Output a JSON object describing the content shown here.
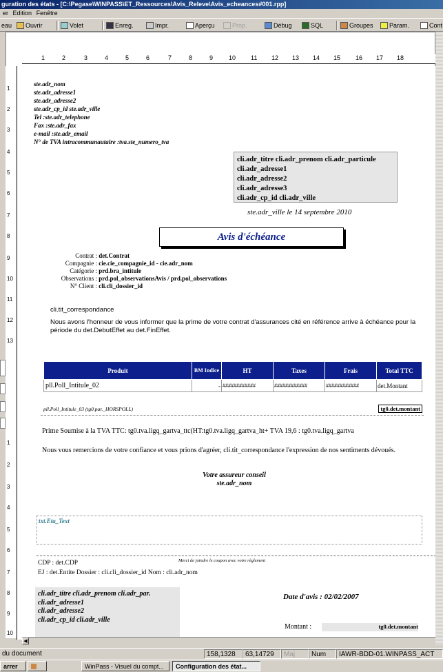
{
  "window": {
    "title": "guration des états - [C:\\Pegase\\WINPASS\\ET_Ressources\\Avis_Releve\\Avis_echeances#001.rpp]"
  },
  "menu": {
    "items": [
      "er",
      "Edition",
      "Fenêtre"
    ]
  },
  "toolbar": {
    "nouveau": "eau",
    "ouvrir": "Ouvrir",
    "volet": "Volet",
    "enreg": "Enreg.",
    "impr": "Impr.",
    "apercu": "Aperçu",
    "prop": "Prop.",
    "debug": "Débug",
    "sql": "SQL",
    "groupes": "Groupes",
    "param": "Param.",
    "cont": "Cont"
  },
  "ruler": {
    "h_ticks": [
      "1",
      "2",
      "3",
      "4",
      "5",
      "6",
      "7",
      "8",
      "9",
      "10",
      "11",
      "12",
      "13",
      "14",
      "15",
      "16",
      "17",
      "18"
    ],
    "v_ticks": [
      "1",
      "2",
      "3",
      "4",
      "5",
      "6",
      "7",
      "8",
      "9",
      "10",
      "11",
      "12",
      "13",
      "1",
      "2",
      "3",
      "4",
      "5",
      "6",
      "7",
      "8",
      "9",
      "10"
    ]
  },
  "report": {
    "sender": {
      "lines": [
        "ste.adr_nom",
        "ste.adr_adresse1",
        "ste.adr_adresse2",
        "ste.adr_cp_id ste.adr_ville",
        "Tel :ste.adr_telephone",
        "Fax :ste.adr_fax",
        "e-mail :ste.adr_email",
        "N° de TVA intracommunautaire :tva.ste_numero_tva"
      ]
    },
    "recipient": {
      "lines": [
        "cli.adr_titre cli.adr_prenom cli.adr_particule",
        "cli.adr_adresse1",
        "cli.adr_adresse2",
        "cli.adr_adresse3",
        "cli.adr_cp_id cli.adr_ville"
      ]
    },
    "place_date": "ste.adr_ville le 14 septembre 2010",
    "title": "Avis d'échéance",
    "contract": [
      {
        "label": "Contrat :",
        "value": "det.Contrat"
      },
      {
        "label": "Compagnie :",
        "value": "cie.cie_compagnie_id - cie.adr_nom"
      },
      {
        "label": "Catégorie :",
        "value": "prd.bra_intitule"
      },
      {
        "label": "Observations :",
        "value": "prd.pol_observationsAvis / prd.pol_observations"
      },
      {
        "label": "N° Client :",
        "value": "cli.cli_dossier_id"
      }
    ],
    "correspondance": "cli.tit_correspondance",
    "intro": "Nous avons l'honneur de vous informer que la prime de votre contrat d'assurances cité en référence arrive à échéance pour la période du det.DebutEffet au det.FinEffet.",
    "table": {
      "headers": [
        "Produit",
        "BM Indice",
        "HT",
        "Taxes",
        "Frais",
        "Total TTC"
      ],
      "row": [
        "pll.Poll_Intitule_02",
        "-",
        "############",
        "############",
        "############",
        "det.Montant"
      ]
    },
    "subline": {
      "left": "pll.Poll_Intitule_03 (tg0.par._HORSPOLL)",
      "right": "tg0.det.montant"
    },
    "prime": "Prime Soumise à la TVA TTC: tg0.tva.ligq_gartva_ttc(HT:tg0.tva.ligq_gartva_ht+ TVA 19,6 : tg0.tva.ligq_gartva",
    "thanks": "Nous vous remercions de votre confiance et vous prions d'agréer, cli.tit_correspondance l'expression de nos sentiments dévoués.",
    "signature": [
      "Votre assureur conseil",
      "ste.adr_nom"
    ],
    "eta_text": "txt.Eta_Text",
    "coupon_note": "Merci de joindre le coupon avec votre règlement",
    "cdp": "CDP : det.CDP",
    "ej": "EJ : det.Entite Dossier : cli.cli_dossier_id Nom : cli.adr_nom",
    "coupon_addr": [
      "cli.adr_titre cli.adr_prenom cli.adr_par.",
      "cli.adr_adresse1",
      "cli.adr_adresse2",
      "cli.adr_cp_id cli.adr_ville"
    ],
    "date_avis": "Date d'avis : 02/02/2007",
    "montant_label": "Montant :",
    "montant_value": "tg0.det.montant"
  },
  "status": {
    "doc": "du document",
    "x": "158,1328",
    "y": "63,14729",
    "maj": "Maj",
    "num": "Num",
    "server": "IAWR-BDD-01.WINPASS_ACT"
  },
  "taskbar": {
    "start": "arrer",
    "task1": "WinPass - Visuel du compt...",
    "task2": "Configuration des état..."
  }
}
